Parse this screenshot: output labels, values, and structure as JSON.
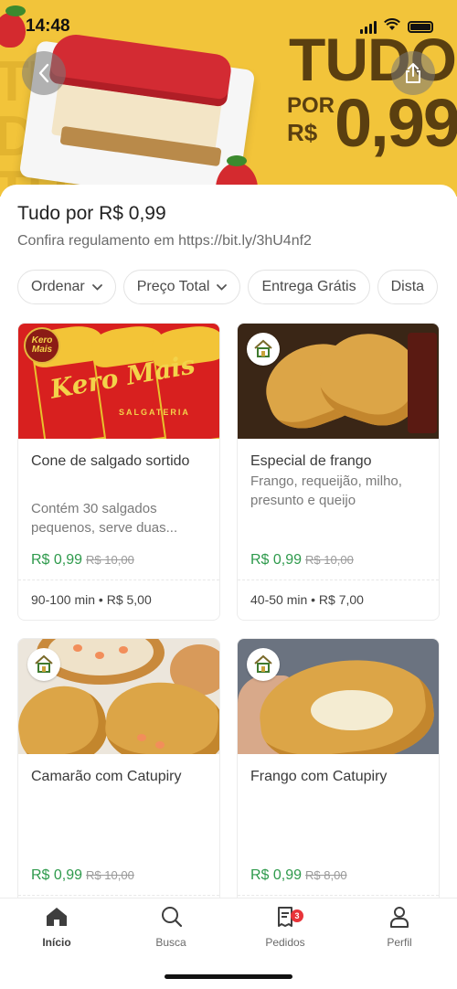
{
  "status_bar": {
    "time": "14:48"
  },
  "banner": {
    "tudo": "TUDO",
    "por": "POR",
    "currency": "R$",
    "price": "0,99"
  },
  "page": {
    "title": "Tudo por R$ 0,99",
    "subtitle": "Confira regulamento em https://bit.ly/3hU4nf2"
  },
  "filters": [
    {
      "label": "Ordenar",
      "has_chevron": true
    },
    {
      "label": "Preço Total",
      "has_chevron": true
    },
    {
      "label": "Entrega Grátis",
      "has_chevron": false
    },
    {
      "label": "Dista",
      "has_chevron": false
    }
  ],
  "products": [
    {
      "name": "Cone de salgado sortido",
      "description": "Contém 30 salgados pequenos, serve duas...",
      "price": "R$ 0,99",
      "old_price": "R$ 10,00",
      "meta": "90-100 min • R$ 5,00",
      "image_brand": "Kero Mais",
      "image_brand_tagline": "SALGATERIA"
    },
    {
      "name": "Especial de frango",
      "description": "Frango, requeijão, milho, presunto e queijo",
      "price": "R$ 0,99",
      "old_price": "R$ 10,00",
      "meta": "40-50 min • R$ 7,00"
    },
    {
      "name": "Camarão com Catupiry",
      "description": "",
      "price": "R$ 0,99",
      "old_price": "R$ 10,00",
      "meta": ""
    },
    {
      "name": "Frango com Catupiry",
      "description": "",
      "price": "R$ 0,99",
      "old_price": "R$ 8,00",
      "meta": ""
    }
  ],
  "tabbar": {
    "items": [
      {
        "label": "Início",
        "icon": "home-icon",
        "active": true
      },
      {
        "label": "Busca",
        "icon": "search-icon",
        "active": false
      },
      {
        "label": "Pedidos",
        "icon": "orders-icon",
        "active": false,
        "badge": "3"
      },
      {
        "label": "Perfil",
        "icon": "profile-icon",
        "active": false
      }
    ]
  },
  "colors": {
    "banner_yellow": "#f2c43a",
    "price_green": "#2e9a4c",
    "badge_red": "#e8343a"
  }
}
